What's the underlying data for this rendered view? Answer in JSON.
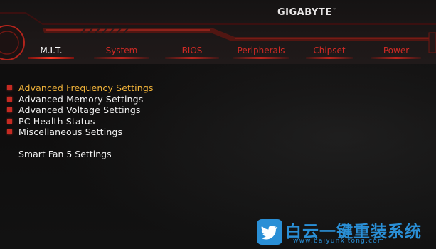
{
  "brand": {
    "name": "GIGABYTE",
    "trademark": "™"
  },
  "tabs": [
    {
      "label": "M.I.T.",
      "active": true
    },
    {
      "label": "System",
      "active": false
    },
    {
      "label": "BIOS",
      "active": false
    },
    {
      "label": "Peripherals",
      "active": false
    },
    {
      "label": "Chipset",
      "active": false
    },
    {
      "label": "Power",
      "active": false
    }
  ],
  "menu": {
    "items": [
      {
        "label": "Advanced Frequency Settings",
        "selected": true
      },
      {
        "label": "Advanced Memory Settings",
        "selected": false
      },
      {
        "label": "Advanced Voltage Settings",
        "selected": false
      },
      {
        "label": "PC Health Status",
        "selected": false
      },
      {
        "label": "Miscellaneous Settings",
        "selected": false
      }
    ],
    "extra": "Smart Fan 5 Settings"
  },
  "watermark": {
    "text": "白云一键重装系统",
    "url": "www.baiyunxitong.com",
    "icon": "twitter-bird-icon",
    "color": "#2a8fd6"
  },
  "colors": {
    "accent_red": "#c52a22",
    "selected_text": "#f2b43a",
    "menu_text": "#f1f1f1"
  }
}
